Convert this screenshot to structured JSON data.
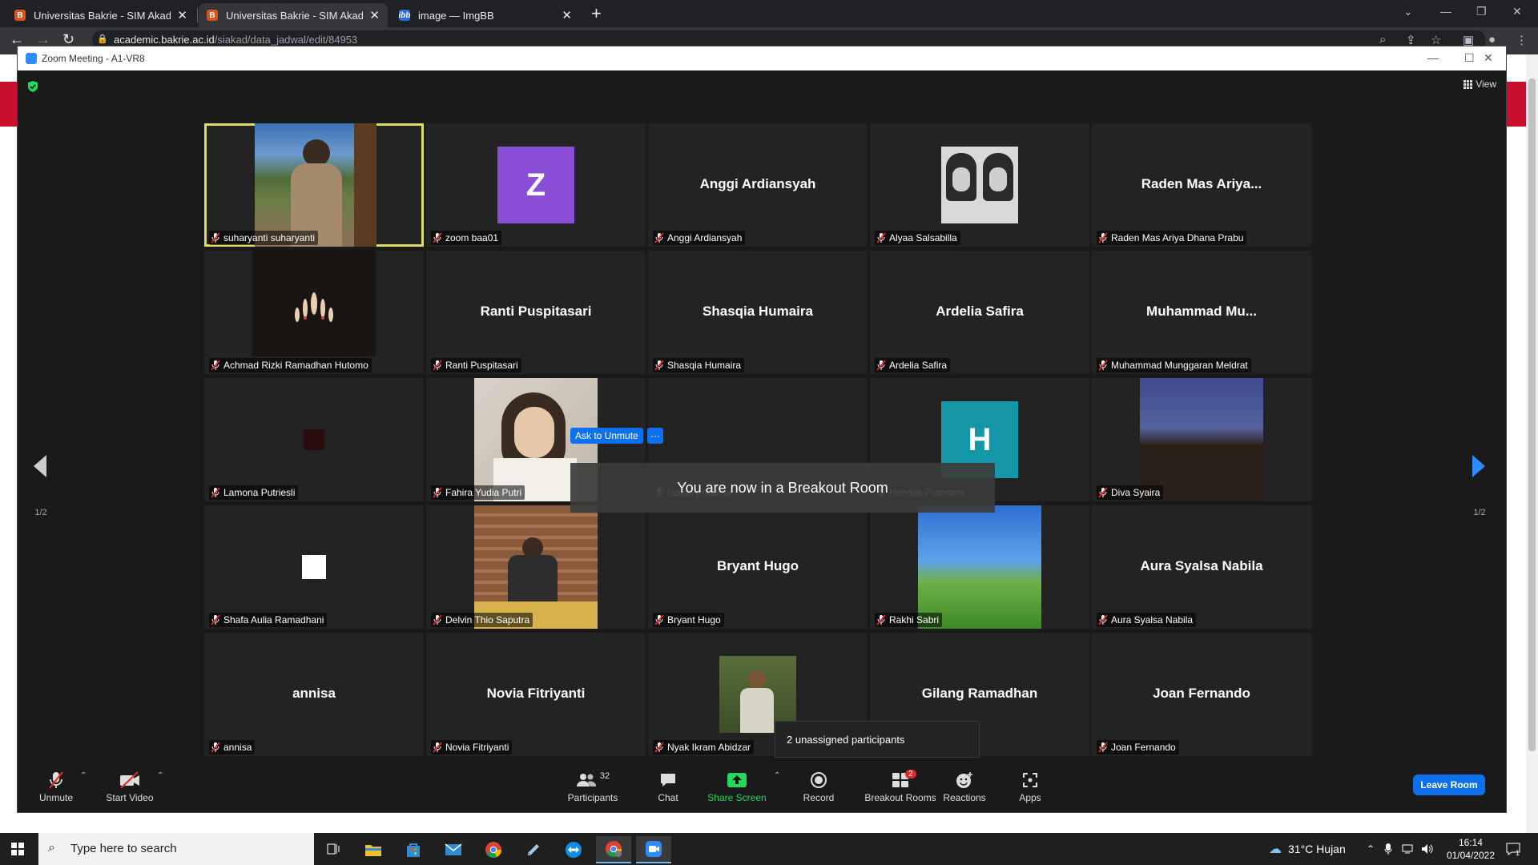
{
  "browser": {
    "tabs": [
      {
        "title": "Universitas Bakrie - SIM Akadem",
        "icon": "bakrie-favicon"
      },
      {
        "title": "Universitas Bakrie - SIM Akadem",
        "icon": "bakrie-favicon"
      },
      {
        "title": "image — ImgBB",
        "icon": "imgbb-favicon",
        "icon_text": "ibb"
      }
    ],
    "url_host": "academic.bakrie.ac.id",
    "url_path": "/siakad/data_jadwal/edit/84953"
  },
  "zoom": {
    "window_title": "Zoom Meeting - A1-VR8",
    "view_label": "View",
    "participants": [
      {
        "name": "suharyanti suharyanti",
        "display": "",
        "speaking": true
      },
      {
        "name": "zoom baa01",
        "display": "",
        "avatar_letter": "Z",
        "avatar_color": "#8a4fd6"
      },
      {
        "name": "Anggi Ardiansyah",
        "display": "Anggi Ardiansyah"
      },
      {
        "name": "Alyaa Salsabilla",
        "display": ""
      },
      {
        "name": "Raden Mas Ariya Dhana Prabu",
        "display": "Raden Mas Ariya..."
      },
      {
        "name": "Achmad Rizki Ramadhan Hutomo",
        "display": ""
      },
      {
        "name": "Ranti Puspitasari",
        "display": "Ranti Puspitasari"
      },
      {
        "name": "Shasqia Humaira",
        "display": "Shasqia Humaira"
      },
      {
        "name": "Ardelia Safira",
        "display": "Ardelia Safira"
      },
      {
        "name": "Muhammad Munggaran Meldrat",
        "display": "Muhammad  Mu..."
      },
      {
        "name": "Lamona Putriesli",
        "display": ""
      },
      {
        "name": "Fahira Yudia Putri",
        "display": ""
      },
      {
        "name": "fabian pratama",
        "display": ""
      },
      {
        "name": "Hendrik Purnomo",
        "display": "",
        "avatar_letter": "H",
        "avatar_color": "#1597a8"
      },
      {
        "name": "Diva Syaira",
        "display": ""
      },
      {
        "name": "Shafa Aulia Ramadhani",
        "display": ""
      },
      {
        "name": "Delvin Thio Saputra",
        "display": ""
      },
      {
        "name": "Bryant Hugo",
        "display": "Bryant Hugo"
      },
      {
        "name": "Rakhi Sabri",
        "display": ""
      },
      {
        "name": "Aura Syalsa Nabila",
        "display": "Aura Syalsa Nabila"
      },
      {
        "name": "annisa",
        "display": "annisa"
      },
      {
        "name": "Novia Fitriyanti",
        "display": "Novia Fitriyanti"
      },
      {
        "name": "Nyak Ikram Abidzar",
        "display": ""
      },
      {
        "name": "Gilang Ramadhan",
        "display": "Gilang Ramadhan"
      },
      {
        "name": "Joan Fernando",
        "display": "Joan Fernando"
      }
    ],
    "ask_to_unmute": "Ask to Unmute",
    "more_dots": "···",
    "breakout_toast": "You are now in a Breakout Room",
    "unassigned_popup": "2 unassigned participants",
    "page_left": "1/2",
    "page_right": "1/2",
    "controls": {
      "unmute": "Unmute",
      "start_video": "Start Video",
      "participants": "Participants",
      "participants_count": "32",
      "chat": "Chat",
      "share_screen": "Share Screen",
      "record": "Record",
      "breakout_rooms": "Breakout Rooms",
      "breakout_badge": "2",
      "reactions": "Reactions",
      "apps": "Apps",
      "leave_room": "Leave Room"
    },
    "accent_color": "#0e71eb",
    "share_color": "#23d959",
    "mute_color": "#e02828"
  },
  "taskbar": {
    "search_placeholder": "Type here to search",
    "weather": "31°C  Hujan",
    "time": "16:14",
    "date": "01/04/2022",
    "notification_count": "1"
  }
}
